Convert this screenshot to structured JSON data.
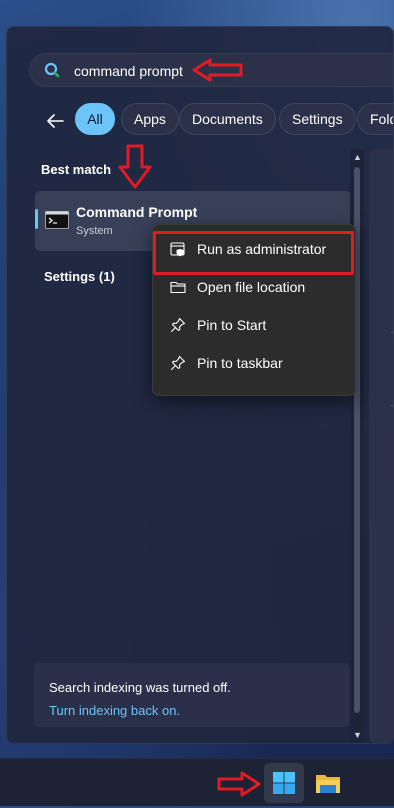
{
  "search": {
    "query": "command prompt"
  },
  "filters": [
    {
      "label": "All",
      "active": true
    },
    {
      "label": "Apps",
      "active": false
    },
    {
      "label": "Documents",
      "active": false
    },
    {
      "label": "Settings",
      "active": false
    },
    {
      "label": "Fold",
      "active": false
    }
  ],
  "best_match": {
    "heading": "Best match",
    "title": "Command Prompt",
    "subtitle": "System"
  },
  "settings_section": {
    "heading": "Settings (1)"
  },
  "context_menu": [
    {
      "label": "Run as administrator",
      "icon": "shield-icon"
    },
    {
      "label": "Open file location",
      "icon": "folder-icon"
    },
    {
      "label": "Pin to Start",
      "icon": "pin-icon"
    },
    {
      "label": "Pin to taskbar",
      "icon": "pin-icon"
    }
  ],
  "notice": {
    "text": "Search indexing was turned off.",
    "link": "Turn indexing back on."
  },
  "colors": {
    "accent": "#6cc4f8",
    "annotation_red": "#e01b24"
  }
}
